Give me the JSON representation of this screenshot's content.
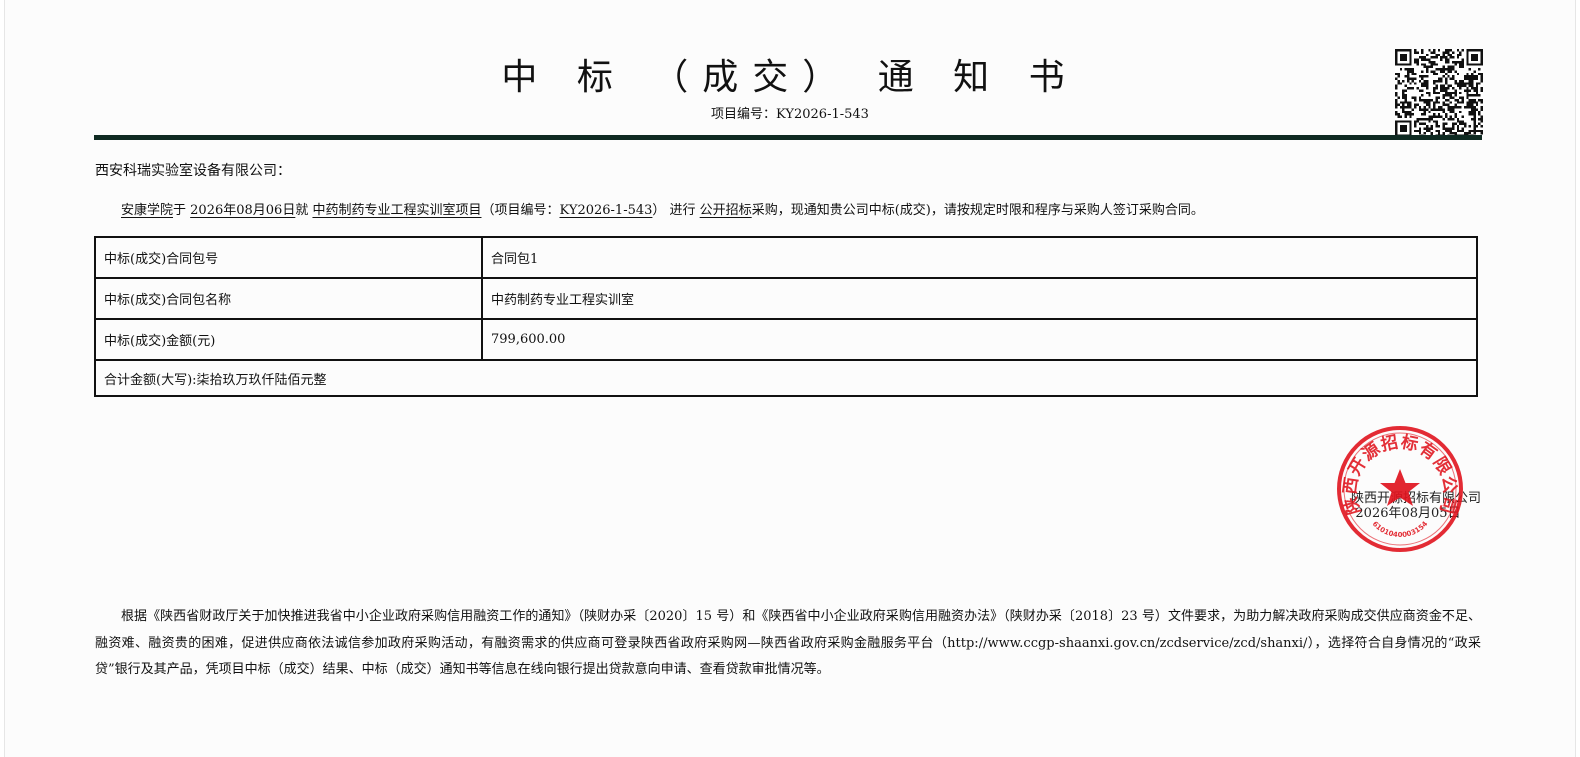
{
  "header": {
    "title": "中 标 （成交） 通 知 书",
    "project_no_text": "项目编号：KY2026-1-543"
  },
  "recipient": "西安科瑞实验室设备有限公司：",
  "notice": {
    "purchaser": "安康学院",
    "text_1": "于 ",
    "date": "2026年08月06日",
    "text_2": "就 ",
    "project_name": "中药制药专业工程实训室项目",
    "text_3": "（项目编号：",
    "project_no": "KY2026-1-543",
    "text_4": "） 进行 ",
    "method": "公开招标",
    "text_5": "采购，现通知贵公司中标(成交)，请按规定时限和程序与采购人签订采购合同。"
  },
  "table": {
    "rows": [
      {
        "label": "中标(成交)合同包号",
        "value": "合同包1"
      },
      {
        "label": "中标(成交)合同包名称",
        "value": "中药制药专业工程实训室"
      },
      {
        "label": "中标(成交)金额(元)",
        "value": "799,600.00"
      }
    ],
    "total_text": "合计金额(大写):柒拾玖万玖仟陆佰元整"
  },
  "signature": {
    "company": "陕西开源招标有限公司",
    "date": "2026年08月05日"
  },
  "seal": {
    "text": "陕西开源招标有限公司",
    "number": "6101040003154",
    "color": "#e0141e"
  },
  "footer_text": "根据《陕西省财政厅关于加快推进我省中小企业政府采购信用融资工作的通知》（陕财办采〔2020〕15 号）和《陕西省中小企业政府采购信用融资办法》（陕财办采〔2018〕23 号）文件要求，为助力解决政府采购成交供应商资金不足、融资难、融资贵的困难，促进供应商依法诚信参加政府采购活动，有融资需求的供应商可登录陕西省政府采购网—陕西省政府采购金融服务平台（http://www.ccgp-shaanxi.gov.cn/zcdservice/zcd/shanxi/），选择符合自身情况的“政采贷”银行及其产品，凭项目中标（成交）结果、中标（成交）通知书等信息在线向银行提出贷款意向申请、查看贷款审批情况等。"
}
